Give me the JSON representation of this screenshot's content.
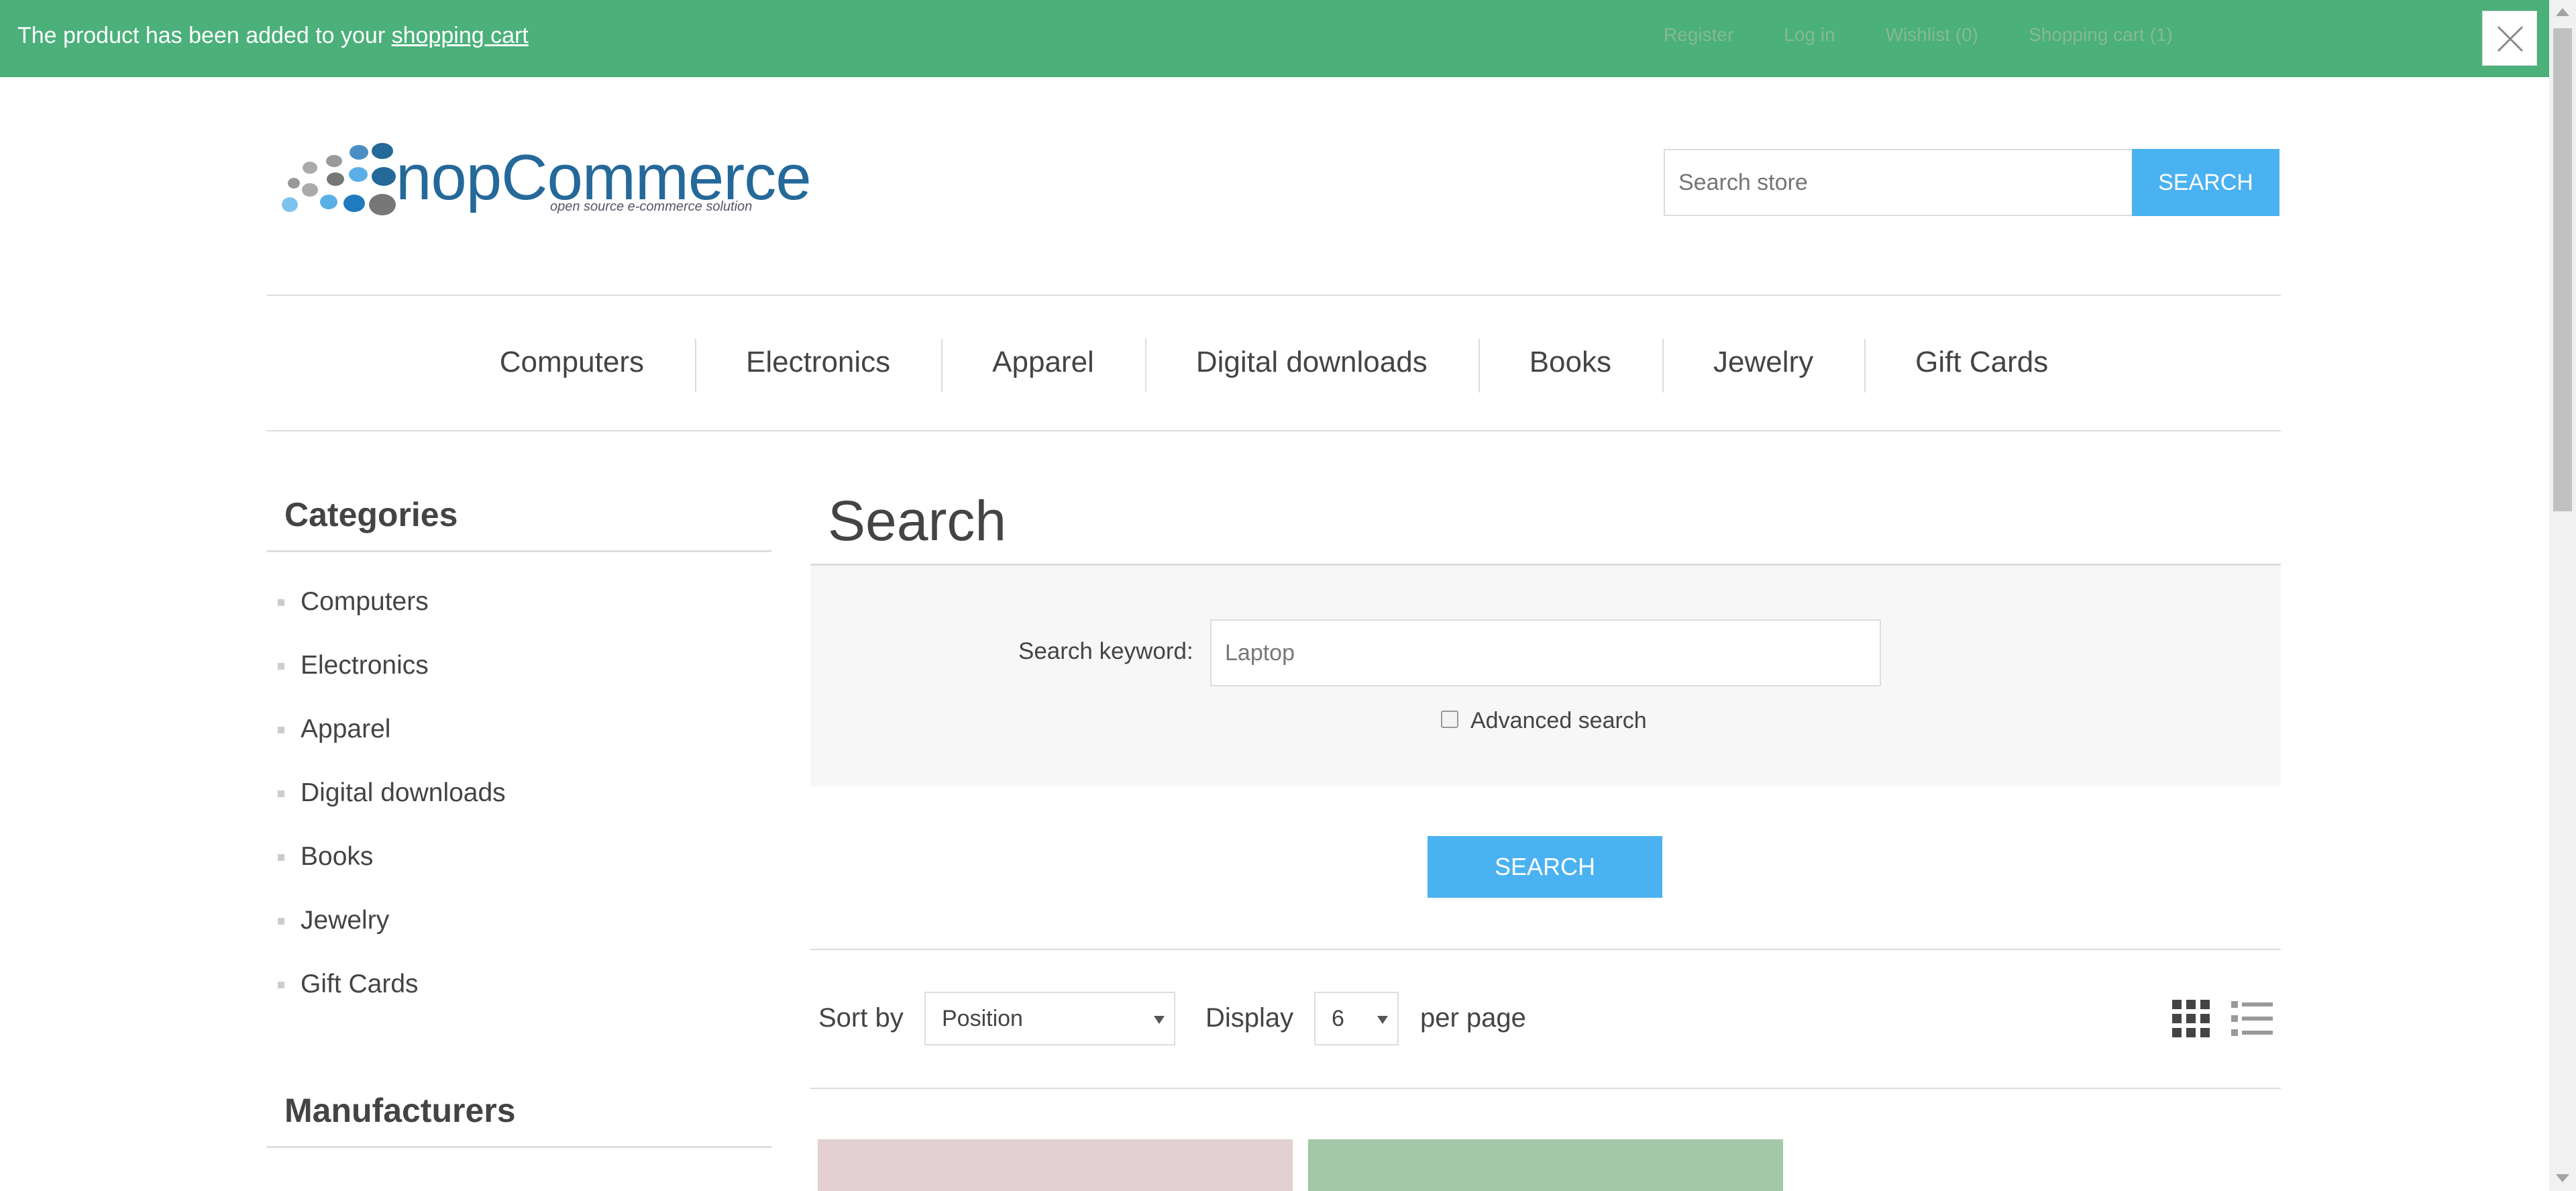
{
  "notification": {
    "message": "The product has been added to your ",
    "link_text": "shopping cart"
  },
  "header_links": [
    "Register",
    "Log in",
    "Wishlist (0)",
    "Shopping cart (1)"
  ],
  "logo": {
    "word": "nopCommerce",
    "tagline": "open source e-commerce solution"
  },
  "search_store": {
    "placeholder": "Search store",
    "button_label": "SEARCH"
  },
  "top_menu": [
    "Computers",
    "Electronics",
    "Apparel",
    "Digital downloads",
    "Books",
    "Jewelry",
    "Gift Cards"
  ],
  "side": {
    "categories_title": "Categories",
    "categories": [
      "Computers",
      "Electronics",
      "Apparel",
      "Digital downloads",
      "Books",
      "Jewelry",
      "Gift Cards"
    ],
    "manufacturers_title": "Manufacturers"
  },
  "search_page": {
    "title": "Search",
    "keyword_label": "Search keyword:",
    "keyword_value": "Laptop",
    "advanced_label": "Advanced search",
    "button_label": "SEARCH"
  },
  "listing": {
    "sort_label": "Sort by",
    "sort_value": "Position",
    "display_label": "Display",
    "display_value": "6",
    "per_page_label": "per page"
  },
  "colors": {
    "notification_bg": "#4bb07a",
    "accent_blue": "#4ab2f1",
    "logo_blue": "#246999"
  }
}
